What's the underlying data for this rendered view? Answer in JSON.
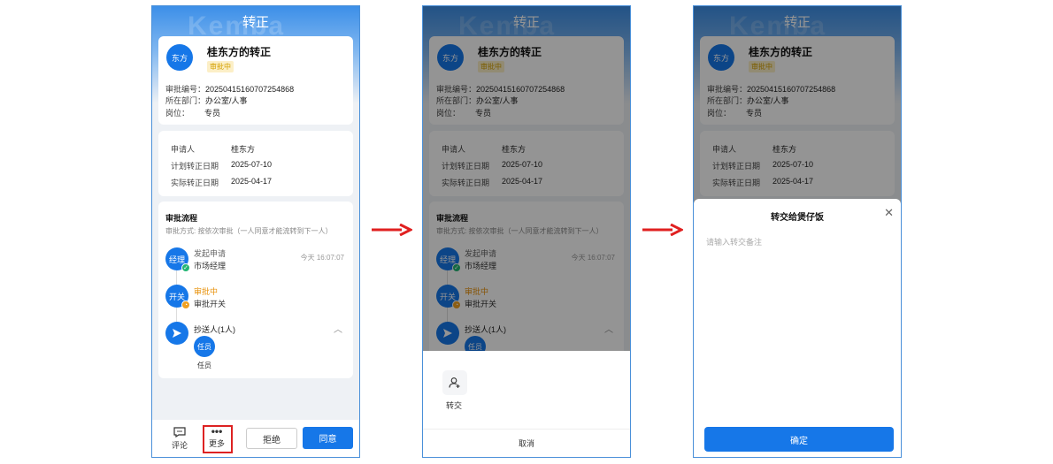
{
  "screen": {
    "title": "转正",
    "watermark": "Kemba",
    "applicant": {
      "avatar_text": "东方",
      "name": "桂东方的转正",
      "status": "审批中",
      "serial_label": "审批编号：",
      "serial": "20250415160707254868",
      "dept_label": "所在部门：",
      "dept": "办公室/人事",
      "position_label": "岗位：",
      "position": "专员"
    },
    "details": [
      {
        "label": "申请人",
        "value": "桂东方"
      },
      {
        "label": "计划转正日期",
        "value": "2025-07-10"
      },
      {
        "label": "实际转正日期",
        "value": "2025-04-17"
      }
    ],
    "flow": {
      "title": "审批流程",
      "mode": "审批方式: 按依次审批（一人同意才能流转到下一人）",
      "steps": [
        {
          "avatar": "经理",
          "title": "发起申请",
          "subtitle": "市场经理",
          "time": "今天 16:07:07"
        },
        {
          "avatar": "开关",
          "title": "审批中",
          "subtitle": "审批开关",
          "time": ""
        }
      ],
      "cc": {
        "title": "抄送人(1人)",
        "person_avatar": "任员",
        "person_name": "任员"
      }
    }
  },
  "bottom_bar": {
    "comment_label": "评论",
    "more_label": "更多",
    "reject_label": "拒绝",
    "approve_label": "同意"
  },
  "more_sheet": {
    "transfer_label": "转交",
    "cancel_label": "取消"
  },
  "transfer_sheet": {
    "title": "转交给煲仔饭",
    "placeholder": "请输入转交备注",
    "confirm_label": "确定"
  },
  "colors": {
    "primary": "#1677e8",
    "pending_orange": "#e8920c",
    "arrow_red": "#e02020",
    "highlight_red": "#dd2222"
  }
}
